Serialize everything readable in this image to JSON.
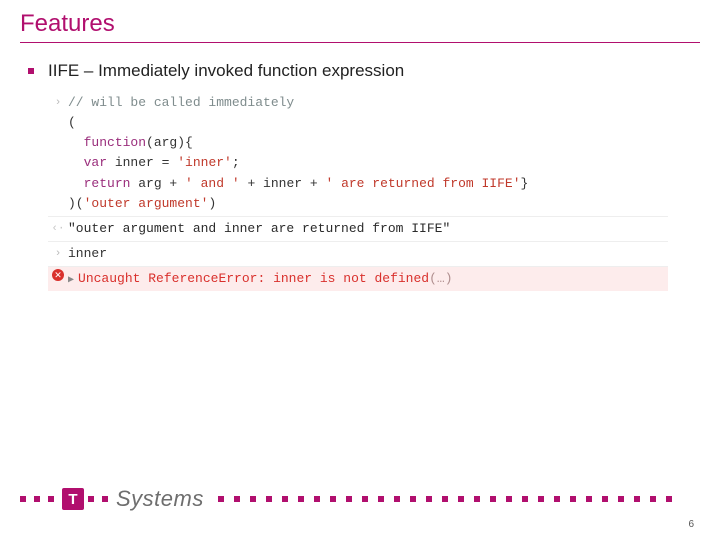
{
  "title": "Features",
  "bullet": "IIFE – Immediately invoked function expression",
  "console": {
    "input1": {
      "l1": "// will be called immediately",
      "l2": "(",
      "l3a": "  ",
      "l3b": "function",
      "l3c": "(arg){",
      "l4a": "  ",
      "l4b": "var",
      "l4c": " inner = ",
      "l4d": "'inner'",
      "l4e": ";",
      "l5a": "  ",
      "l5b": "return",
      "l5c": " arg + ",
      "l5d": "' and '",
      "l5e": " + inner + ",
      "l5f": "' are returned from IIFE'",
      "l5g": "}",
      "l6a": ")(",
      "l6b": "'outer argument'",
      "l6c": ")"
    },
    "output1": "\"outer argument and inner are returned from IIFE\"",
    "input2": "inner",
    "error_main": "Uncaught ReferenceError: inner is not defined",
    "error_tail": "(…)"
  },
  "logo_text": "Systems",
  "logo_t": "T",
  "page_number": "6"
}
